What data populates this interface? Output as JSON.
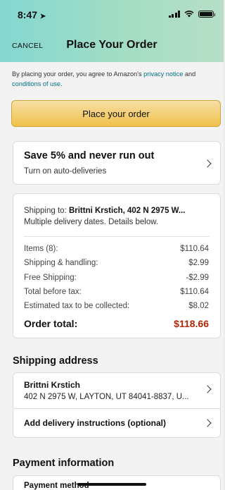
{
  "status_bar": {
    "time": "8:47"
  },
  "nav": {
    "cancel": "CANCEL",
    "title": "Place Your Order"
  },
  "agreement": {
    "prefix": "By placing your order, you agree to Amazon's ",
    "privacy_link": "privacy notice",
    "and": " and ",
    "conditions_link": "conditions of use",
    "suffix": "."
  },
  "place_order_button": "Place your order",
  "subscribe": {
    "title": "Save 5% and never run out",
    "subtitle": "Turn on auto-deliveries"
  },
  "summary": {
    "shipping_label": "Shipping to: ",
    "shipping_to": "Brittni Krstich, 402 N 2975 W...",
    "delivery_note": "Multiple delivery dates. Details below.",
    "rows": [
      {
        "label": "Items (8):",
        "value": "$110.64"
      },
      {
        "label": "Shipping & handling:",
        "value": "$2.99"
      },
      {
        "label": "Free Shipping:",
        "value": "-$2.99"
      },
      {
        "label": "Total before tax:",
        "value": "$110.64"
      },
      {
        "label": "Estimated tax to be collected:",
        "value": "$8.02"
      }
    ],
    "total_label": "Order total:",
    "total_value": "$118.66"
  },
  "shipping": {
    "section_title": "Shipping address",
    "name": "Brittni Krstich",
    "address": "402 N 2975 W, LAYTON, UT 84041-8837, U...",
    "delivery_instructions": "Add delivery instructions (optional)"
  },
  "payment": {
    "section_title": "Payment information",
    "method_label": "Payment method"
  }
}
